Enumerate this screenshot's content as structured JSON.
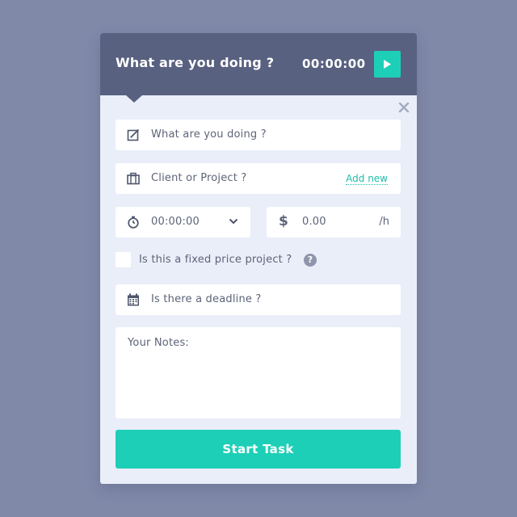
{
  "header": {
    "title": "What are you doing ?",
    "timer": "00:00:00",
    "play_icon": "play-icon"
  },
  "colors": {
    "background": "#8189a9",
    "header": "#596180",
    "panel": "#e9eef9",
    "accent": "#1ecfb7"
  },
  "form": {
    "task_placeholder": "What are you doing ?",
    "task_icon": "edit-icon",
    "client_placeholder": "Client or Project ?",
    "client_icon": "briefcase-icon",
    "add_new_label": "Add new",
    "time_value": "00:00:00",
    "time_icon": "stopwatch-icon",
    "rate_value": "0.00",
    "rate_currency": "$",
    "rate_suffix": "/h",
    "fixed_price_label": "Is this a fixed price project ?",
    "fixed_price_checked": false,
    "help_symbol": "?",
    "deadline_placeholder": "Is there a deadline ?",
    "deadline_icon": "calendar-icon",
    "notes_label": "Your Notes:"
  },
  "actions": {
    "start_label": "Start Task",
    "close_icon": "close-icon"
  }
}
